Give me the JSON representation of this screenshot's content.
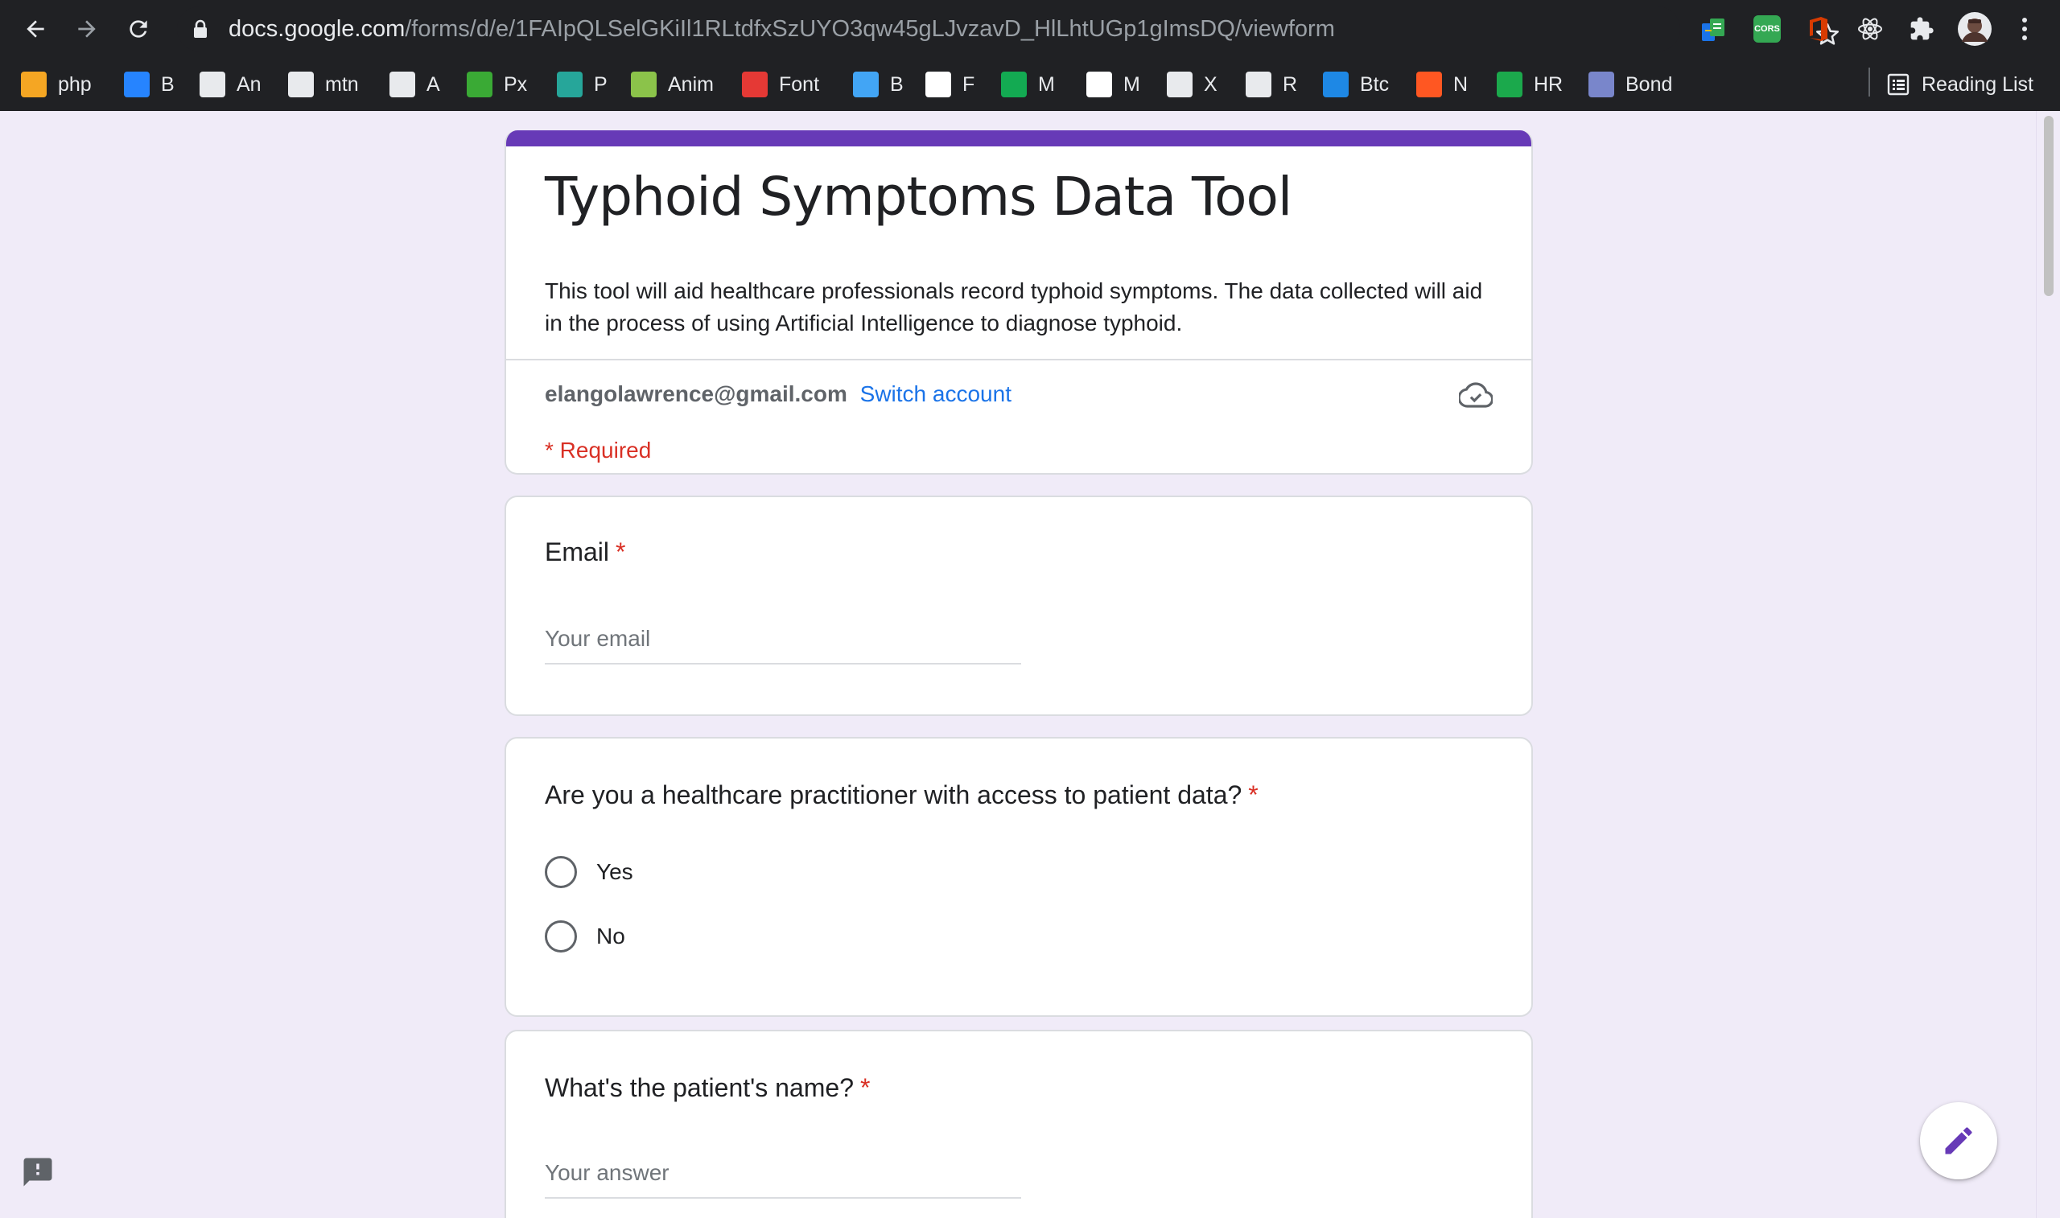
{
  "browser": {
    "url_host": "docs.google.com",
    "url_path": "/forms/d/e/1FAIpQLSelGKiIl1RLtdfxSzUYO3qw45gLJvzavD_HlLhtUGp1gImsDQ/viewform",
    "extensions": [
      {
        "name": "sheets-extension-icon",
        "color": "#1a73e8"
      },
      {
        "name": "cors-extension-icon",
        "label": "CORS",
        "color": "#34a853"
      },
      {
        "name": "office-extension-icon",
        "color": "#d83b01"
      },
      {
        "name": "react-devtools-icon",
        "color": "#e8eaed"
      },
      {
        "name": "puzzle-extensions-icon",
        "color": "#e8eaed"
      }
    ],
    "bookmarks": [
      {
        "label": "php",
        "icon": "php-icon",
        "color": "#f5a623"
      },
      {
        "label": "B",
        "icon": "bitbucket-icon",
        "color": "#2684ff"
      },
      {
        "label": "An",
        "icon": "globe-icon",
        "color": "#e8eaed"
      },
      {
        "label": "mtn",
        "icon": "globe-icon",
        "color": "#e8eaed"
      },
      {
        "label": "A",
        "icon": "github-icon",
        "color": "#e8eaed"
      },
      {
        "label": "Px",
        "icon": "px-icon",
        "color": "#3aaa35"
      },
      {
        "label": "P",
        "icon": "p-icon",
        "color": "#26a69a"
      },
      {
        "label": "Anim",
        "icon": "anim-icon",
        "color": "#8bc34a"
      },
      {
        "label": "Font",
        "icon": "font-icon",
        "color": "#e53935"
      },
      {
        "label": "B",
        "icon": "behance-icon",
        "color": "#42a5f5"
      },
      {
        "label": "F",
        "icon": "f-icon",
        "color": "#ffffff"
      },
      {
        "label": "M",
        "icon": "mongodb-icon",
        "color": "#13aa52"
      },
      {
        "label": "M",
        "icon": "medium-icon",
        "color": "#ffffff"
      },
      {
        "label": "X",
        "icon": "x-icon",
        "color": "#e8eaed"
      },
      {
        "label": "R",
        "icon": "r-icon",
        "color": "#e8eaed"
      },
      {
        "label": "Btc",
        "icon": "btc-icon",
        "color": "#1e88e5"
      },
      {
        "label": "N",
        "icon": "n-icon",
        "color": "#ff5722"
      },
      {
        "label": "HR",
        "icon": "hackerrank-icon",
        "color": "#1ba94c"
      },
      {
        "label": "Bond",
        "icon": "bond-icon",
        "color": "#7986cb"
      }
    ],
    "reading_list": "Reading List"
  },
  "form": {
    "accent_color": "#673ab7",
    "title": "Typhoid Symptoms Data Tool",
    "description": "This tool will aid healthcare professionals record typhoid symptoms. The data collected will aid in the process of using Artificial Intelligence to diagnose typhoid.",
    "account_email": "elangolawrence@gmail.com",
    "switch_account": "Switch account",
    "required_note": "* Required",
    "questions": [
      {
        "title": "Email",
        "required": "*",
        "placeholder": "Your email"
      },
      {
        "title": "Are you a healthcare practitioner with access to patient data?",
        "required": "*",
        "options": [
          "Yes",
          "No"
        ]
      },
      {
        "title": "What's the patient's name?",
        "required": "*",
        "placeholder": "Your answer"
      }
    ]
  }
}
